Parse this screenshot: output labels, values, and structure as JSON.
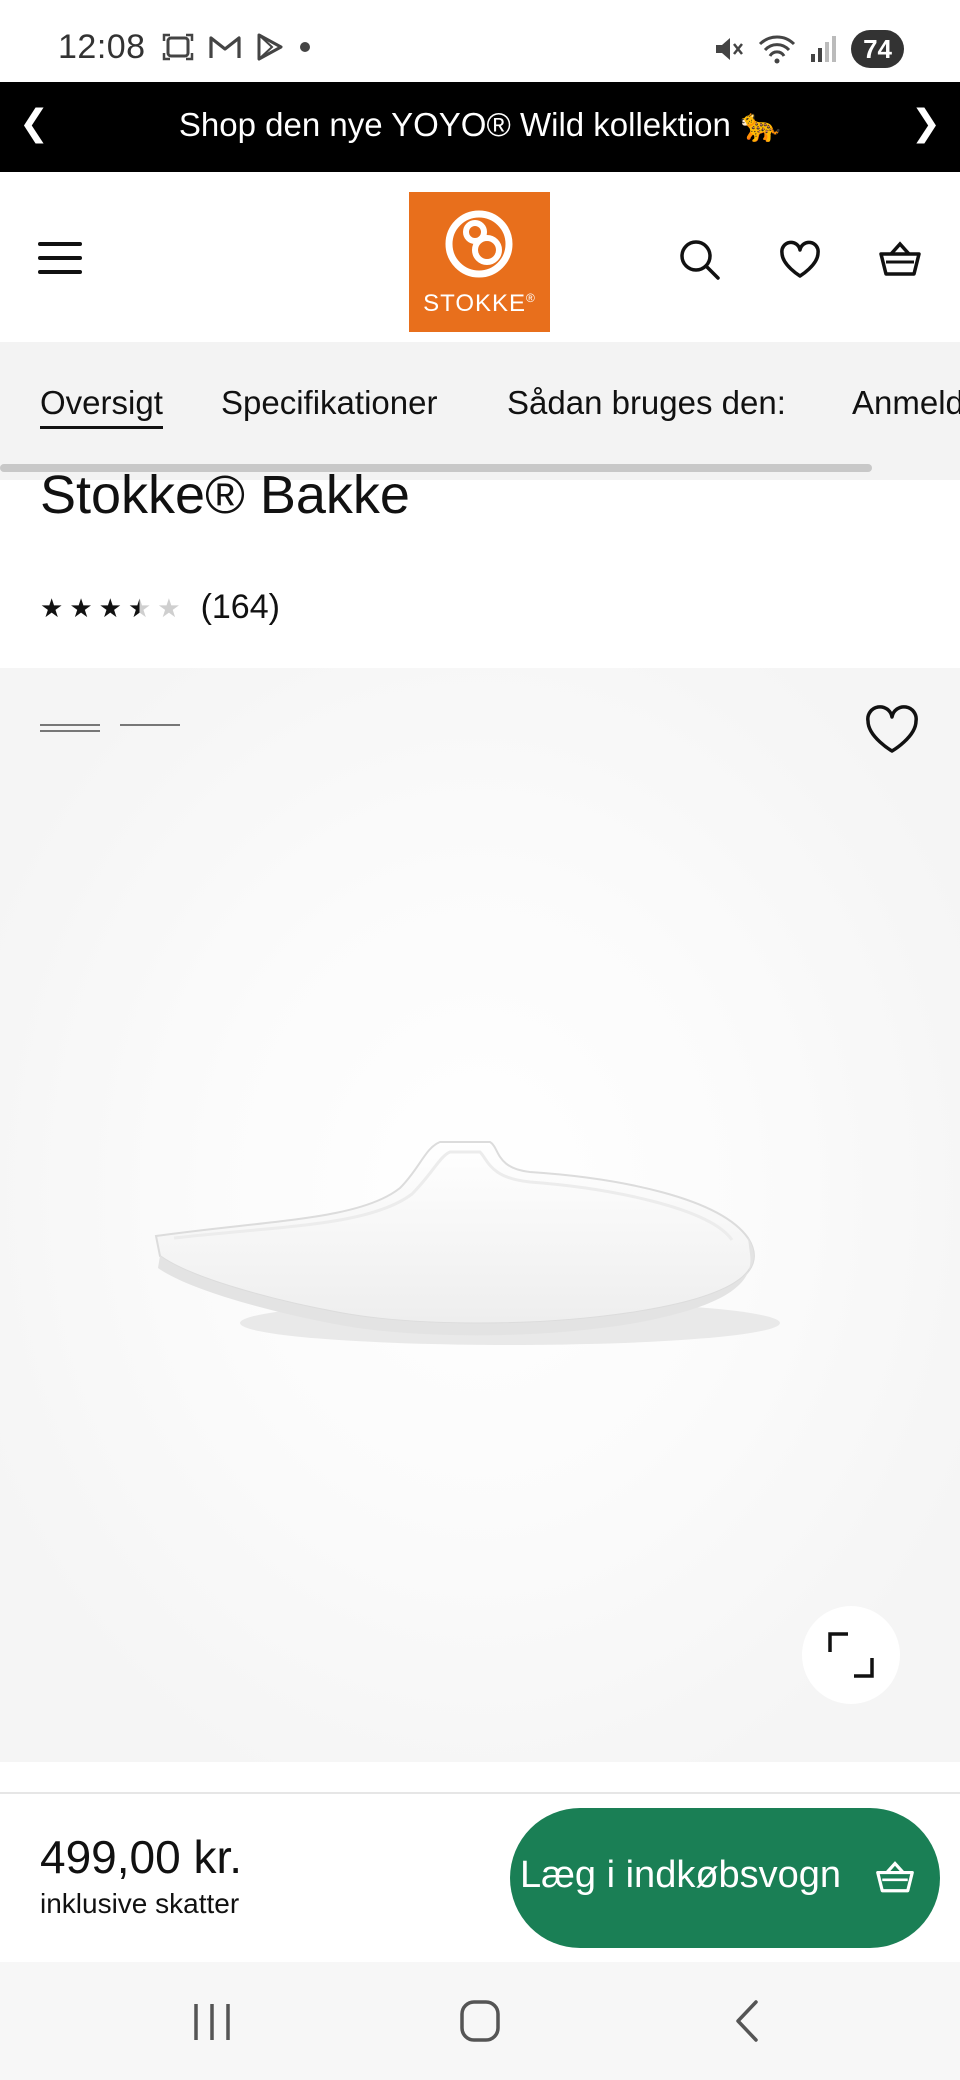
{
  "status_bar": {
    "time": "12:08",
    "battery": "74",
    "left_icons": [
      "screenshot-icon",
      "gmail-icon",
      "play-store-icon",
      "dot-icon"
    ],
    "right_icons": [
      "mute-icon",
      "wifi-icon",
      "signal-icon"
    ]
  },
  "promo": {
    "text": "Shop den nye YOYO® Wild kollektion 🐆",
    "prev_glyph": "❮",
    "next_glyph": "❯"
  },
  "header": {
    "logo_text": "STOKKE",
    "logo_mark": "®",
    "brand_color": "#e86f1c",
    "icons": [
      "menu-icon",
      "search-icon",
      "heart-icon",
      "basket-icon"
    ]
  },
  "tabs": [
    {
      "label": "Oversigt",
      "active": true
    },
    {
      "label": "Specifikationer",
      "active": false
    },
    {
      "label": "Sådan bruges den:",
      "active": false
    },
    {
      "label": "Anmeld",
      "active": false
    }
  ],
  "product": {
    "title": "Stokke® Bakke",
    "rating": 3.5,
    "rating_max": 5,
    "review_count": "(164)"
  },
  "gallery": {
    "image_count": 2,
    "active_index": 0,
    "image_subject": "white tray"
  },
  "buy_bar": {
    "price": "499,00 kr.",
    "tax_note": "inklusive skatter",
    "add_to_cart_label": "Læg i indkøbsvogn",
    "button_color": "#1a7f55"
  },
  "nav_bar": {
    "buttons": [
      "recent-apps-icon",
      "home-icon",
      "back-icon"
    ]
  }
}
